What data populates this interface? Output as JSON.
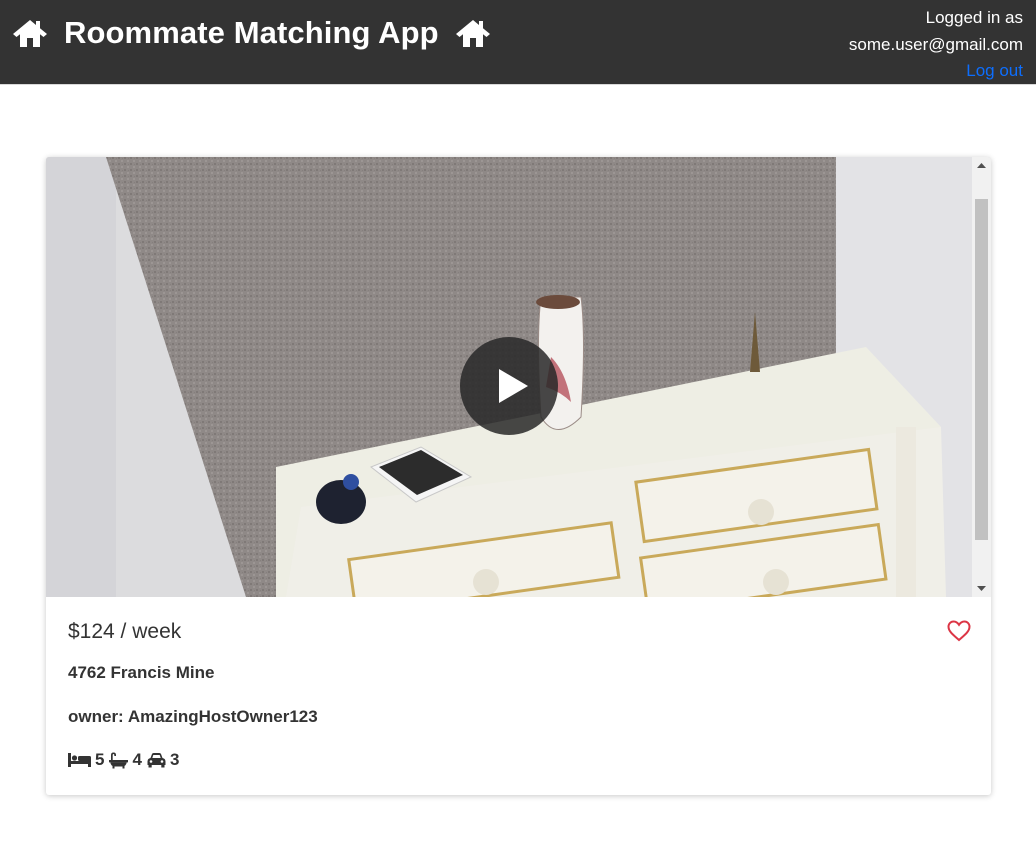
{
  "header": {
    "app_title": "Roommate Matching App",
    "logged_in_label": "Logged in as",
    "user_email": "some.user@gmail.com",
    "logout_label": "Log out",
    "left_icon": "home-icon",
    "right_icon": "home-icon"
  },
  "listing": {
    "price": "$124 / week",
    "address": "4762 Francis Mine",
    "owner": "owner: AmazingHostOwner123",
    "bedrooms": "5",
    "bathrooms": "4",
    "parking": "3",
    "icons": [
      "bed-icon",
      "bath-icon",
      "car-icon",
      "heart-icon",
      "play-icon"
    ],
    "favorite_color": "#dc3545"
  },
  "colors": {
    "navbar": "#333333",
    "link": "#0d6efd"
  }
}
